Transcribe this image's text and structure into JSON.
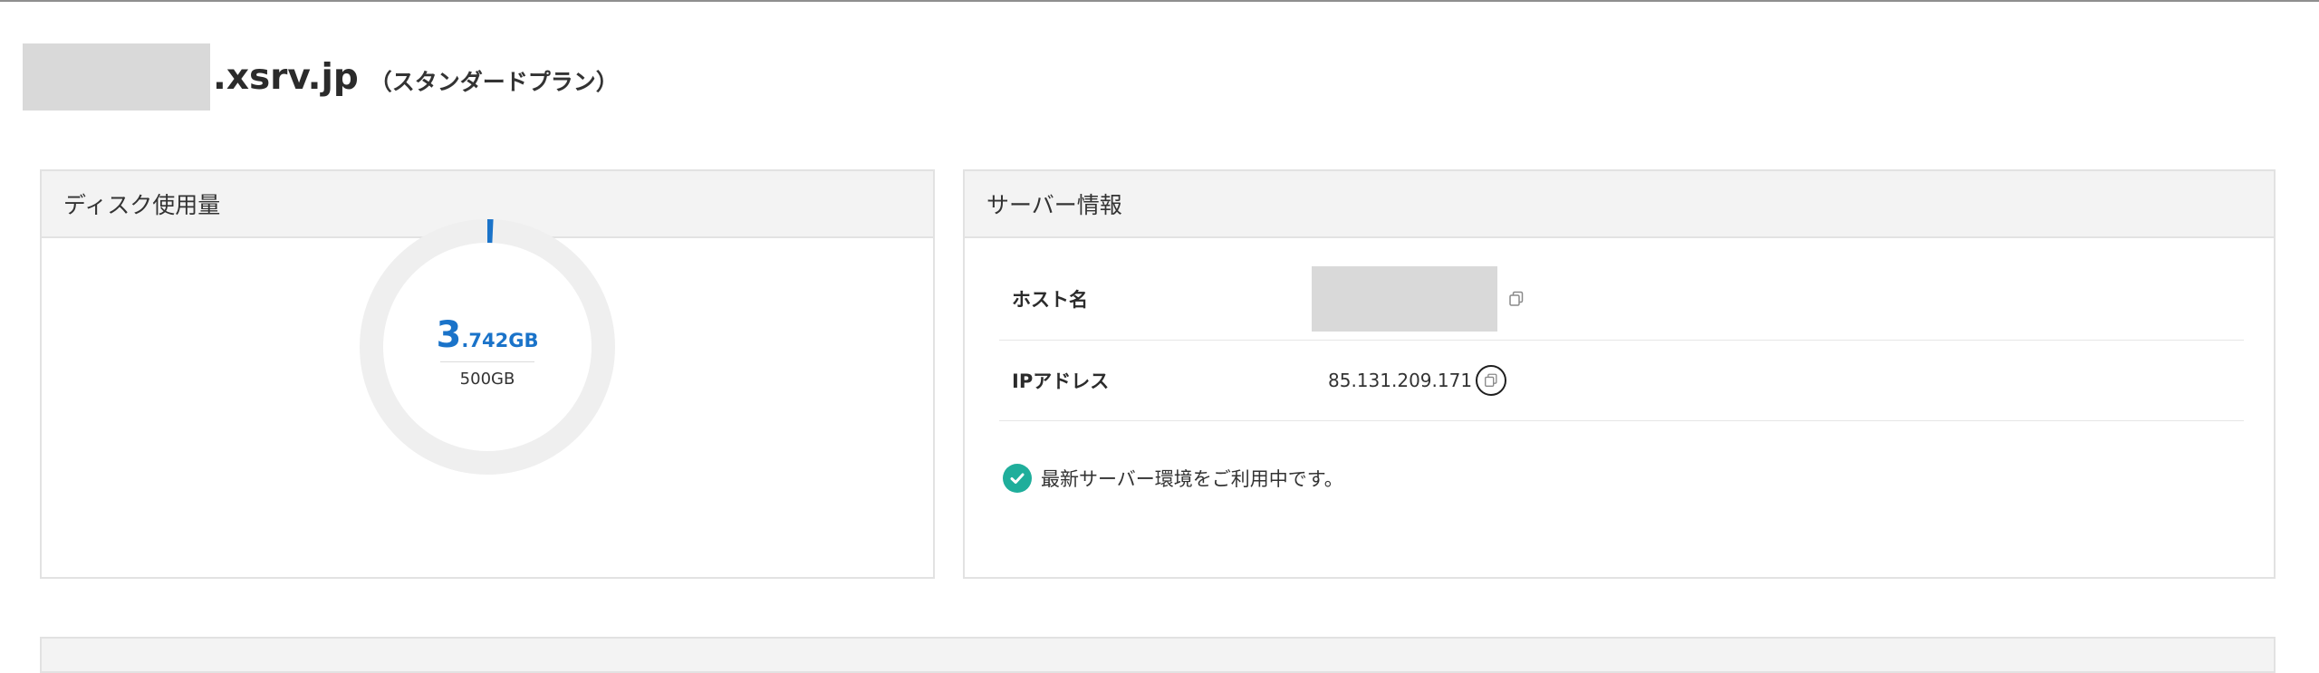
{
  "header": {
    "domain_suffix": ".xsrv.jp",
    "plan": "（スタンダードプラン）"
  },
  "disk_panel": {
    "title": "ディスク使用量",
    "used_int": "3",
    "used_dec": ".742GB",
    "total": "500GB",
    "used_fraction": 0.0075,
    "accent_color": "#1a73c9",
    "track_color": "#efefef"
  },
  "server_panel": {
    "title": "サーバー情報",
    "host_label": "ホスト名",
    "ip_label": "IPアドレス",
    "ip_value": "85.131.209.171",
    "status_text": "最新サーバー環境をご利用中です。",
    "status_color": "#1fae9b",
    "copy_icon": "copy-icon",
    "check_icon": "check-icon"
  }
}
